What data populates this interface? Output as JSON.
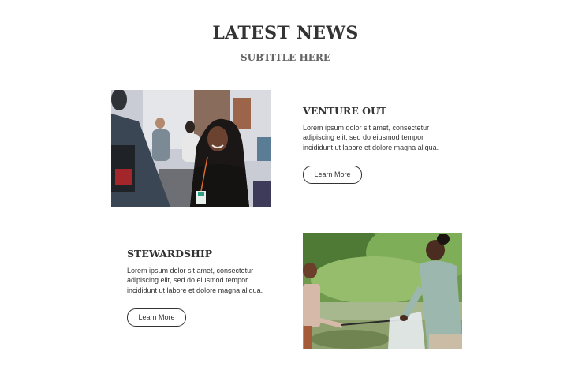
{
  "header": {
    "title": "LATEST NEWS",
    "subtitle": "SUBTITLE HERE"
  },
  "articles": [
    {
      "title": "VENTURE OUT",
      "body": "Lorem ipsum dolor sit amet, consectetur adipiscing elit, sed do eiusmod tempor incididunt ut labore et dolore magna aliqua.",
      "button_label": "Learn More",
      "image_subject": "woman-at-event-photo"
    },
    {
      "title": "STEWARDSHIP",
      "body": "Lorem ipsum dolor sit amet, consectetur adipiscing elit, sed do eiusmod tempor incididunt ut labore et dolore magna aliqua.",
      "button_label": "Learn More",
      "image_subject": "woman-and-child-cleanup-photo"
    }
  ],
  "colors": {
    "text": "#333333",
    "subtitle": "#666666",
    "background": "#ffffff"
  }
}
